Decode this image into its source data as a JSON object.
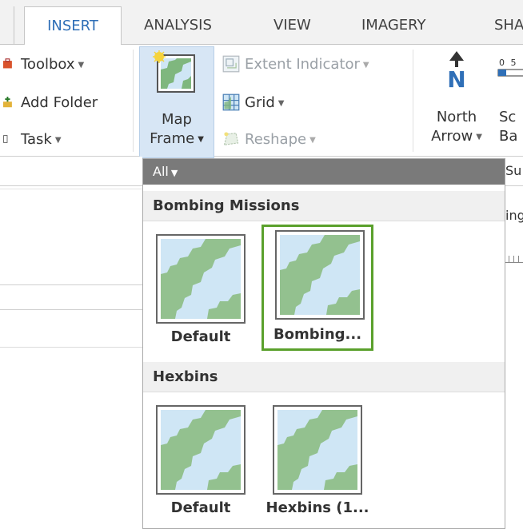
{
  "tabs": [
    {
      "label": "INSERT",
      "active": true
    },
    {
      "label": "ANALYSIS"
    },
    {
      "label": "VIEW"
    },
    {
      "label": "IMAGERY"
    },
    {
      "label": "SHA"
    }
  ],
  "ribbon": {
    "toolbox": "Toolbox",
    "add_folder": "Add Folder",
    "task": "Task",
    "map_frame_line1": "Map",
    "map_frame_line2": "Frame",
    "extent_indicator": "Extent Indicator",
    "grid": "Grid",
    "reshape": "Reshape",
    "north_line1": "North",
    "north_line2": "Arrow",
    "north_letter": "N",
    "scale_line1": "Sc",
    "scale_line2": "Ba",
    "scale_ticks": "0  5"
  },
  "gallery": {
    "filter": "All",
    "sections": [
      {
        "title": "Bombing Missions",
        "items": [
          {
            "label": "Default"
          },
          {
            "label": "Bombing...",
            "selected": true
          }
        ]
      },
      {
        "title": "Hexbins",
        "items": [
          {
            "label": "Default"
          },
          {
            "label": "Hexbins (1..."
          }
        ]
      }
    ]
  },
  "partial": {
    "su": "Su",
    "ing": "ing"
  },
  "colors": {
    "accent": "#2f6fb7",
    "selection": "#5aa02c",
    "land": "#93c18f",
    "water": "#cfe6f5"
  }
}
